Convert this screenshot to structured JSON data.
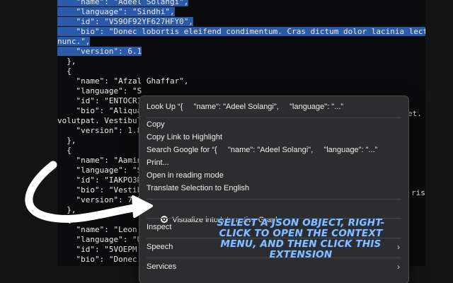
{
  "code_lines": [
    {
      "text": "    \"name\": \"Adeel Solangi\",",
      "selected": true
    },
    {
      "text": "    \"language\": \"Sindhi\",",
      "selected": true
    },
    {
      "text": "    \"id\": \"V59OF92YF627HFY0\",",
      "selected": true
    },
    {
      "text": "    \"bio\": \"Donec lobortis eleifend condimentum. Cras dictum dolor lacinia lectus",
      "selected": true
    },
    {
      "text": "nunc.\",",
      "selected": true
    },
    {
      "text": "    \"version\": 6.1",
      "selected": true
    },
    {
      "text": "  },",
      "selected": false
    },
    {
      "text": "  {",
      "selected": false
    },
    {
      "text": "    \"name\": \"Afzal Ghaffar\",",
      "selected": false
    },
    {
      "text": "    \"language\": \"S",
      "selected": false
    },
    {
      "text": "    \"id\": \"ENTOCR1",
      "selected": false
    },
    {
      "text": "    \"bio\": \"Aliqua",
      "selected": false
    },
    {
      "text": "volutpat. Vestibul",
      "selected": false
    },
    {
      "text": "    \"version\": 1.8",
      "selected": false
    },
    {
      "text": "  },",
      "selected": false
    },
    {
      "text": "  {",
      "selected": false
    },
    {
      "text": "    \"name\": \"Aamin",
      "selected": false
    },
    {
      "text": "    \"language\": \"S",
      "selected": false
    },
    {
      "text": "    \"id\": \"IAKPO3R",
      "selected": false
    },
    {
      "text": "    \"bio\": \"Vestib",
      "selected": false
    },
    {
      "text": "    \"version\": 7.2",
      "selected": false
    },
    {
      "text": "  },",
      "selected": false
    },
    {
      "text": "  {",
      "selected": false
    },
    {
      "text": "    \"name\": \"Leon",
      "selected": false
    },
    {
      "text": "    \"language\": \"U",
      "selected": false
    },
    {
      "text": "    \"id\": \"5VOEPM",
      "selected": false
    },
    {
      "text": "    \"bio\": \"Donec",
      "selected": false
    },
    {
      "text": "    \"version\": 2.5",
      "selected": false
    }
  ],
  "code_right_fragments": {
    "row_11": "et. P",
    "row_19": "ris"
  },
  "menu": {
    "look_up": "Look Up “{     \"name\": \"Adeel Solangi\",     \"language\": \"...”",
    "copy": "Copy",
    "copy_link": "Copy Link to Highlight",
    "search_google": "Search Google for “{     \"name\": \"Adeel Solangi\",     \"language\": \"...”",
    "print": "Print...",
    "reading_mode": "Open in reading mode",
    "translate": "Translate Selection to English",
    "visualize": "Visualize into Interactive Graph",
    "inspect": "Inspect",
    "speech": "Speech",
    "services": "Services"
  },
  "callout_text": "SELECT A JSON OBJECT, RIGHT-CLICK TO OPEN THE CONTEXT MENU, AND THEN CLICK THIS EXTENSION",
  "icons": {
    "extension": "extension-radio-icon",
    "submenu": "chevron-right-icon",
    "pointer": "curved-arrow-icon"
  },
  "colors": {
    "selection": "#2b5aa8",
    "menu_bg": "#2d2d2f",
    "callout": "#8fbcf2"
  }
}
